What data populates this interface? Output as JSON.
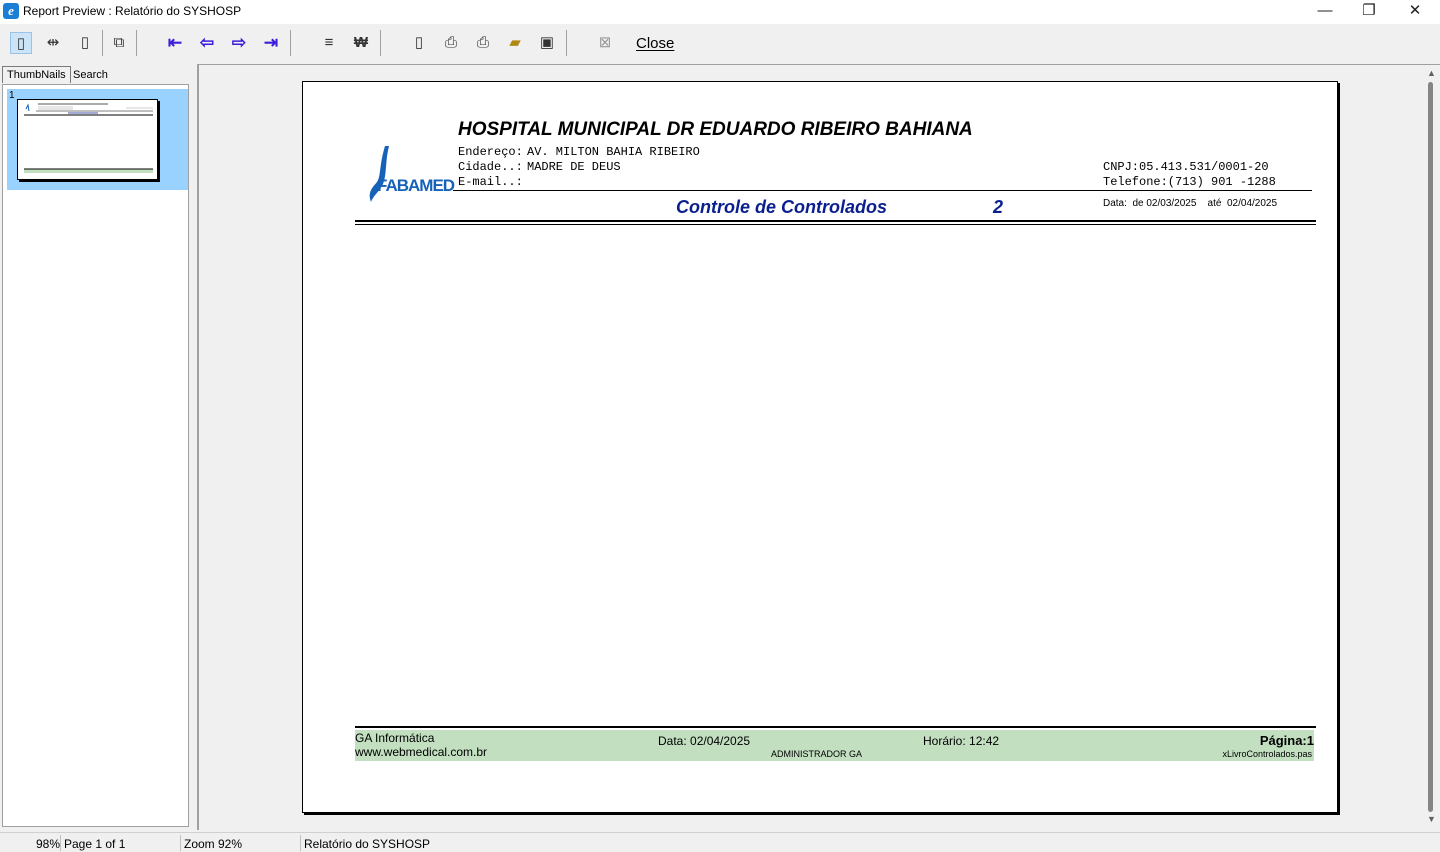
{
  "window": {
    "title": "Report Preview : Relatório do SYSHOSP",
    "minimize": "—",
    "maximize": "❐",
    "close": "✕"
  },
  "toolbar": {
    "close_label": "Close",
    "icons": [
      "page-icon",
      "page-width-icon",
      "full-page-icon",
      "two-pages-icon",
      "first-page-icon",
      "prev-page-icon",
      "next-page-icon",
      "last-page-icon",
      "export-icon",
      "find-icon",
      "new-icon",
      "print-setup-icon",
      "print-icon",
      "open-icon",
      "save-icon",
      "cancel-icon"
    ]
  },
  "tabs": {
    "thumbnails": "ThumbNails",
    "search_results": "Search Results"
  },
  "thumbnail": {
    "page_number": "1"
  },
  "report": {
    "hospital_name": "HOSPITAL MUNICIPAL DR EDUARDO RIBEIRO BAHIANA",
    "address_label": "Endereço:",
    "address_value": "AV. MILTON BAHIA RIBEIRO",
    "city_label": "Cidade..:",
    "city_value": "MADRE DE DEUS",
    "email_label": "E-mail..:",
    "cnpj": "CNPJ:05.413.531/0001-20",
    "phone": "Telefone:(713) 901 -1288",
    "logo_text": "FABAMED",
    "report_title": "Controle de Controlados",
    "report_number": "2",
    "date_range": "Data:  de 02/03/2025    até  02/04/2025",
    "brand_color": "#1662b8",
    "title_color": "#0a1f8f",
    "footer": {
      "company": "GA Informática",
      "website": "www.webmedical.com.br",
      "date": "Data: 02/04/2025",
      "user": "ADMINISTRADOR GA",
      "time": "Horário: 12:42",
      "page": "Página:1",
      "file": "xLivroControlados.pas",
      "band_color": "#c2dfc0"
    }
  },
  "status": {
    "percent": "98%",
    "page": "Page 1 of 1",
    "zoom": "Zoom 92%",
    "report_name": "Relatório do SYSHOSP"
  }
}
